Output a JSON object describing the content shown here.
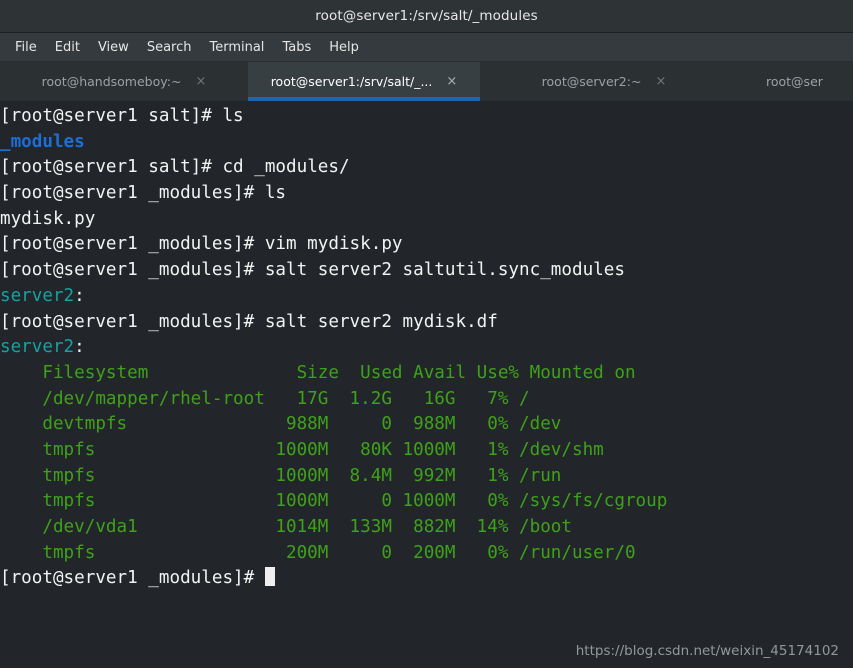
{
  "window": {
    "title": "root@server1:/srv/salt/_modules"
  },
  "menubar": {
    "items": [
      {
        "label": "File"
      },
      {
        "label": "Edit"
      },
      {
        "label": "View"
      },
      {
        "label": "Search"
      },
      {
        "label": "Terminal"
      },
      {
        "label": "Tabs"
      },
      {
        "label": "Help"
      }
    ]
  },
  "tabs": {
    "close_glyph": "×",
    "items": [
      {
        "label": "root@handsomeboy:~",
        "active": false
      },
      {
        "label": "root@server1:/srv/salt/_...",
        "active": true
      },
      {
        "label": "root@server2:~",
        "active": false
      },
      {
        "label": "root@ser",
        "active": false
      }
    ]
  },
  "terminal": {
    "prompt_salt": "[root@server1 salt]# ",
    "prompt_modules": "[root@server1 _modules]# ",
    "colors": {
      "background": "#22262a",
      "prompt_fg": "#f2f2f2",
      "directory_blue": "#1c6fd8",
      "minion_cyan": "#14a3a3",
      "output_green": "#3fa11a",
      "cursor": "#efefef",
      "tab_accent": "#1c66b8"
    },
    "lines": [
      {
        "type": "command",
        "prompt": "[root@server1 salt]# ",
        "command": "ls"
      },
      {
        "type": "dir_listing",
        "text": "_modules"
      },
      {
        "type": "command",
        "prompt": "[root@server1 salt]# ",
        "command": "cd _modules/"
      },
      {
        "type": "command",
        "prompt": "[root@server1 _modules]# ",
        "command": "ls"
      },
      {
        "type": "plain",
        "text": "mydisk.py"
      },
      {
        "type": "command",
        "prompt": "[root@server1 _modules]# ",
        "command": "vim mydisk.py"
      },
      {
        "type": "command",
        "prompt": "[root@server1 _modules]# ",
        "command": "salt server2 saltutil.sync_modules"
      },
      {
        "type": "minion",
        "minion": "server2",
        "suffix": ":"
      },
      {
        "type": "command",
        "prompt": "[root@server1 _modules]# ",
        "command": "salt server2 mydisk.df"
      },
      {
        "type": "minion",
        "minion": "server2",
        "suffix": ":"
      },
      {
        "type": "df_header",
        "text": "    Filesystem              Size  Used Avail Use% Mounted on"
      },
      {
        "type": "df_row",
        "text": "    /dev/mapper/rhel-root   17G  1.2G   16G   7% /"
      },
      {
        "type": "df_row",
        "text": "    devtmpfs               988M     0  988M   0% /dev"
      },
      {
        "type": "df_row",
        "text": "    tmpfs                 1000M   80K 1000M   1% /dev/shm"
      },
      {
        "type": "df_row",
        "text": "    tmpfs                 1000M  8.4M  992M   1% /run"
      },
      {
        "type": "df_row",
        "text": "    tmpfs                 1000M     0 1000M   0% /sys/fs/cgroup"
      },
      {
        "type": "df_row",
        "text": "    /dev/vda1             1014M  133M  882M  14% /boot"
      },
      {
        "type": "df_row",
        "text": "    tmpfs                  200M     0  200M   0% /run/user/0"
      },
      {
        "type": "prompt_cursor",
        "prompt": "[root@server1 _modules]# "
      }
    ],
    "df_table": {
      "headers": [
        "Filesystem",
        "Size",
        "Used",
        "Avail",
        "Use%",
        "Mounted on"
      ],
      "rows": [
        [
          "/dev/mapper/rhel-root",
          "17G",
          "1.2G",
          "16G",
          "7%",
          "/"
        ],
        [
          "devtmpfs",
          "988M",
          "0",
          "988M",
          "0%",
          "/dev"
        ],
        [
          "tmpfs",
          "1000M",
          "80K",
          "1000M",
          "1%",
          "/dev/shm"
        ],
        [
          "tmpfs",
          "1000M",
          "8.4M",
          "992M",
          "1%",
          "/run"
        ],
        [
          "tmpfs",
          "1000M",
          "0",
          "1000M",
          "0%",
          "/sys/fs/cgroup"
        ],
        [
          "/dev/vda1",
          "1014M",
          "133M",
          "882M",
          "14%",
          "/boot"
        ],
        [
          "tmpfs",
          "200M",
          "0",
          "200M",
          "0%",
          "/run/user/0"
        ]
      ]
    }
  },
  "watermark": {
    "text": "https://blog.csdn.net/weixin_45174102"
  }
}
